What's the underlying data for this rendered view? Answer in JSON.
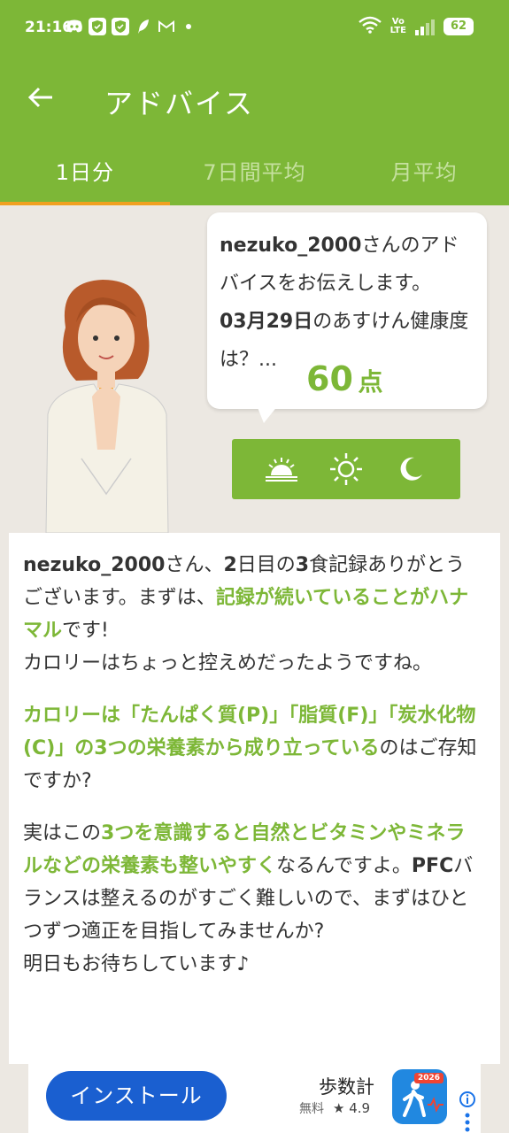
{
  "status_bar": {
    "time": "21:16",
    "network": "Vo\nLTE",
    "battery": "62"
  },
  "header": {
    "title": "アドバイス"
  },
  "tabs": [
    {
      "label": "1日分",
      "active": true
    },
    {
      "label": "7日間平均",
      "active": false
    },
    {
      "label": "月平均",
      "active": false
    }
  ],
  "bubble": {
    "username": "nezuko_2000",
    "line1_suffix": "さんのアドバイスをお伝えします。",
    "date": "03月29日",
    "line2_suffix": "のあすけん健康度は？...",
    "score": "60",
    "score_unit": "点"
  },
  "time_of_day": [
    "sunrise-icon",
    "sun-icon",
    "moon-icon"
  ],
  "advice": {
    "p1": {
      "username": "nezuko_2000",
      "a": "さん、",
      "day": "2",
      "b": "日目の",
      "meals": "3",
      "c": "食記録ありがとうございます。まずは、",
      "hl": "記録が続いていることがハナマル",
      "d": "です!",
      "e": "カロリーはちょっと控えめだったようですね。"
    },
    "p2": {
      "hl": "カロリーは「たんぱく質(P)」「脂質(F)」「炭水化物(C)」の3つの栄養素から成り立っている",
      "a": "のはご存知ですか?"
    },
    "p3": {
      "a": "実はこの",
      "hl": "3つを意識すると自然とビタミンやミネラルなどの栄養素も整いやすく",
      "b": "なるんですよ。",
      "pfc": "PFC",
      "c": "バランスは整えるのがすごく難しいので、まずはひとつずつ適正を目指してみませんか?",
      "d": "明日もお待ちしています♪"
    }
  },
  "ad": {
    "install_label": "インストール",
    "app_name": "歩数計",
    "price": "無料",
    "rating": "★ 4.9",
    "icon_badge": "2026"
  },
  "colors": {
    "brand_green": "#7db737",
    "tab_indicator": "#f0a020",
    "install_blue": "#1a5fd0"
  }
}
